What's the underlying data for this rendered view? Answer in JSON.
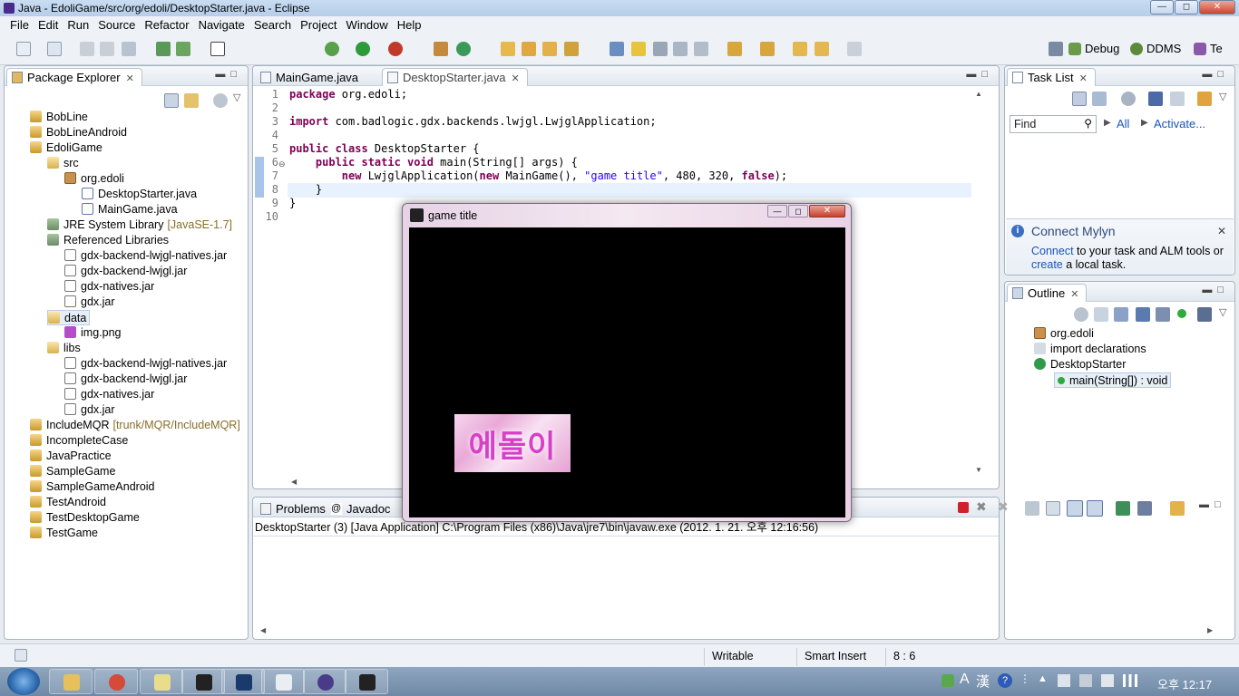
{
  "window": {
    "title": "Java - EdoliGame/src/org/edoli/DesktopStarter.java - Eclipse"
  },
  "menu": [
    "File",
    "Edit",
    "Run",
    "Source",
    "Refactor",
    "Navigate",
    "Search",
    "Project",
    "Window",
    "Help"
  ],
  "perspectives": {
    "debug": "Debug",
    "ddms": "DDMS",
    "te": "Te"
  },
  "package_explorer": {
    "title": "Package Explorer",
    "items": [
      {
        "label": "BobLine",
        "icon": "project-icon"
      },
      {
        "label": "BobLineAndroid",
        "icon": "project-icon"
      },
      {
        "label": "EdoliGame",
        "icon": "project-icon"
      },
      {
        "label": "src",
        "icon": "source-folder-icon"
      },
      {
        "label": "org.edoli",
        "icon": "package-icon"
      },
      {
        "label": "DesktopStarter.java",
        "icon": "java-file-icon"
      },
      {
        "label": "MainGame.java",
        "icon": "java-file-icon"
      },
      {
        "label": "JRE System Library",
        "decoration": "[JavaSE-1.7]",
        "icon": "library-icon"
      },
      {
        "label": "Referenced Libraries",
        "icon": "library-icon"
      },
      {
        "label": "gdx-backend-lwjgl-natives.jar",
        "icon": "jar-icon"
      },
      {
        "label": "gdx-backend-lwjgl.jar",
        "icon": "jar-icon"
      },
      {
        "label": "gdx-natives.jar",
        "icon": "jar-icon"
      },
      {
        "label": "gdx.jar",
        "icon": "jar-icon"
      },
      {
        "label": "data",
        "icon": "folder-icon"
      },
      {
        "label": "img.png",
        "icon": "png-file-icon"
      },
      {
        "label": "libs",
        "icon": "folder-icon"
      },
      {
        "label": "gdx-backend-lwjgl-natives.jar",
        "icon": "jar-icon"
      },
      {
        "label": "gdx-backend-lwjgl.jar",
        "icon": "jar-icon"
      },
      {
        "label": "gdx-natives.jar",
        "icon": "jar-icon"
      },
      {
        "label": "gdx.jar",
        "icon": "jar-icon"
      },
      {
        "label": "IncludeMQR",
        "decoration": "[trunk/MQR/IncludeMQR]",
        "icon": "project-icon"
      },
      {
        "label": "IncompleteCase",
        "icon": "project-icon"
      },
      {
        "label": "JavaPractice",
        "icon": "project-icon"
      },
      {
        "label": "SampleGame",
        "icon": "project-icon"
      },
      {
        "label": "SampleGameAndroid",
        "icon": "project-icon"
      },
      {
        "label": "TestAndroid",
        "icon": "project-icon"
      },
      {
        "label": "TestDesktopGame",
        "icon": "project-icon"
      },
      {
        "label": "TestGame",
        "icon": "project-icon"
      }
    ]
  },
  "editor": {
    "tabs": [
      {
        "label": "MainGame.java",
        "active": false
      },
      {
        "label": "DesktopStarter.java",
        "active": true
      }
    ],
    "line_numbers": [
      "1",
      "2",
      "3",
      "4",
      "5",
      "6",
      "7",
      "8",
      "9",
      "10"
    ],
    "lines": [
      {
        "kw": "package",
        "rest": " org.edoli;"
      },
      {
        "kw": "",
        "rest": ""
      },
      {
        "kw": "import",
        "rest": " com.badlogic.gdx.backends.lwjgl.LwjglApplication;"
      },
      {
        "kw": "",
        "rest": ""
      },
      {
        "kw": "public class",
        "rest": " DesktopStarter {"
      },
      {
        "kw": "    public static void",
        "rest": " main(String[] args) {"
      },
      {
        "pre": "        ",
        "kw": "new",
        "mid": " LwjglApplication(",
        "kw2": "new",
        "mid2": " MainGame(), ",
        "str": "\"game title\"",
        "rest": ", 480, 320, ",
        "kw3": "false",
        "end": ");"
      },
      {
        "kw": "",
        "rest": "    }"
      },
      {
        "kw": "",
        "rest": "}"
      },
      {
        "kw": "",
        "rest": ""
      }
    ]
  },
  "task_list": {
    "title": "Task List",
    "find_placeholder": "Find",
    "all_label": "All",
    "activate_label": "Activate..."
  },
  "mylyn": {
    "title": "Connect Mylyn",
    "connect_link": "Connect",
    "text1": " to your task and ALM tools or",
    "create_link": "create",
    "text2": " a local task."
  },
  "outline": {
    "title": "Outline",
    "items": [
      {
        "label": "org.edoli"
      },
      {
        "label": "import declarations"
      },
      {
        "label": "DesktopStarter"
      },
      {
        "label": "main(String[]) : void"
      }
    ]
  },
  "console": {
    "tabs": [
      "Problems",
      "Javadoc"
    ],
    "launch_text": "DesktopStarter (3) [Java Application] C:\\Program Files (x86)\\Java\\jre7\\bin\\javaw.exe (2012. 1. 21. 오후 12:16:56)"
  },
  "game_window": {
    "title": "game title",
    "sprite_text": "에돌이"
  },
  "status": {
    "writable": "Writable",
    "insert_mode": "Smart Insert",
    "position": "8 : 6"
  },
  "taskbar": {
    "ime1": "A",
    "ime2": "漢",
    "clock": "오후 12:17"
  }
}
